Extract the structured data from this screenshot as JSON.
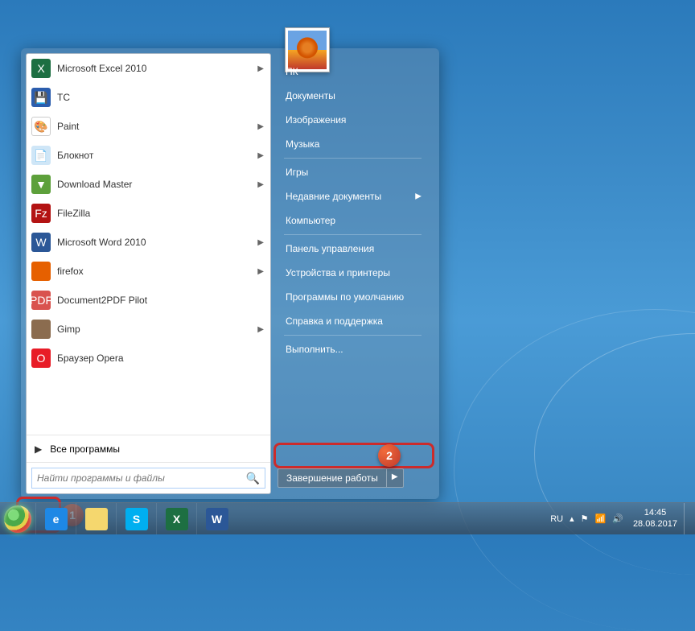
{
  "start_menu": {
    "programs": [
      {
        "label": "Microsoft Excel 2010",
        "icon_class": "i-excel",
        "glyph": "X",
        "has_submenu": true
      },
      {
        "label": "TC",
        "icon_class": "i-tc",
        "glyph": "💾",
        "has_submenu": false
      },
      {
        "label": "Paint",
        "icon_class": "i-paint",
        "glyph": "🎨",
        "has_submenu": true
      },
      {
        "label": "Блокнот",
        "icon_class": "i-notepad",
        "glyph": "📄",
        "has_submenu": true
      },
      {
        "label": "Download Master",
        "icon_class": "i-dm",
        "glyph": "▼",
        "has_submenu": true
      },
      {
        "label": "FileZilla",
        "icon_class": "i-fz",
        "glyph": "Fz",
        "has_submenu": false
      },
      {
        "label": "Microsoft Word 2010",
        "icon_class": "i-word",
        "glyph": "W",
        "has_submenu": true
      },
      {
        "label": "firefox",
        "icon_class": "i-ff",
        "glyph": "",
        "has_submenu": true
      },
      {
        "label": "Document2PDF Pilot",
        "icon_class": "i-pdf",
        "glyph": "PDF",
        "has_submenu": false
      },
      {
        "label": "Gimp",
        "icon_class": "i-gimp",
        "glyph": "",
        "has_submenu": true
      },
      {
        "label": "Браузер Opera",
        "icon_class": "i-opera",
        "glyph": "O",
        "has_submenu": false
      }
    ],
    "all_programs": "Все программы",
    "search_placeholder": "Найти программы и файлы",
    "right_items": [
      {
        "label": "ПК",
        "sep_after": false,
        "has_submenu": false
      },
      {
        "label": "Документы",
        "sep_after": false,
        "has_submenu": false
      },
      {
        "label": "Изображения",
        "sep_after": false,
        "has_submenu": false
      },
      {
        "label": "Музыка",
        "sep_after": true,
        "has_submenu": false
      },
      {
        "label": "Игры",
        "sep_after": false,
        "has_submenu": false
      },
      {
        "label": "Недавние документы",
        "sep_after": false,
        "has_submenu": true
      },
      {
        "label": "Компьютер",
        "sep_after": true,
        "has_submenu": false
      },
      {
        "label": "Панель управления",
        "sep_after": false,
        "has_submenu": false
      },
      {
        "label": "Устройства и принтеры",
        "sep_after": false,
        "has_submenu": false
      },
      {
        "label": "Программы по умолчанию",
        "sep_after": false,
        "has_submenu": false
      },
      {
        "label": "Справка и поддержка",
        "sep_after": true,
        "has_submenu": false
      },
      {
        "label": "Выполнить...",
        "sep_after": false,
        "has_submenu": false
      }
    ],
    "shutdown": "Завершение работы"
  },
  "taskbar": {
    "pinned": [
      {
        "name": "internet-explorer",
        "icon_class": "i-ie",
        "glyph": "e"
      },
      {
        "name": "file-explorer",
        "icon_class": "i-explorer",
        "glyph": ""
      },
      {
        "name": "skype",
        "icon_class": "i-skype",
        "glyph": "S"
      },
      {
        "name": "excel",
        "icon_class": "i-excel",
        "glyph": "X"
      },
      {
        "name": "word",
        "icon_class": "i-word",
        "glyph": "W"
      }
    ],
    "lang": "RU",
    "time": "14:45",
    "date": "28.08.2017"
  },
  "annotations": {
    "badge1": "1",
    "badge2": "2"
  }
}
